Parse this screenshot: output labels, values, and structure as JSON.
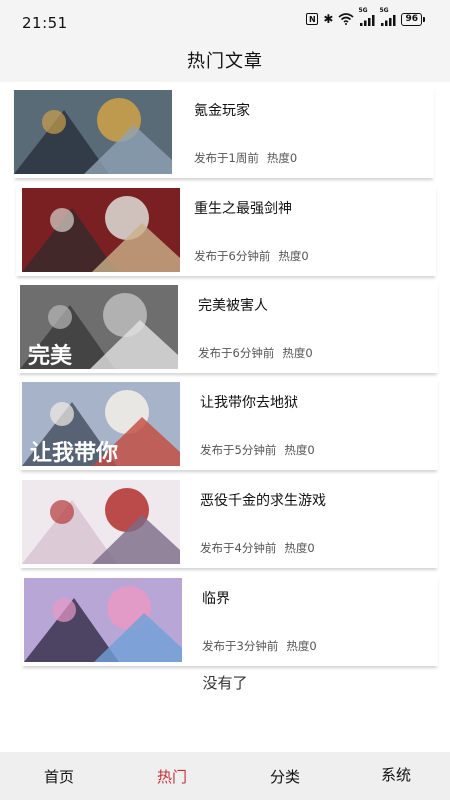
{
  "status_bar": {
    "time": "21:51",
    "icons": [
      "nfc-icon",
      "bluetooth-icon",
      "wifi-icon",
      "signal-5g-icon",
      "signal-5g-icon",
      "battery-icon"
    ],
    "signal_label": "5G",
    "battery": "96"
  },
  "header": {
    "title": "热门文章"
  },
  "articles": [
    {
      "title": "氪金玩家",
      "published": "发布于1周前",
      "heat": "热度0",
      "thumb_colors": [
        "#5a6b78",
        "#c9a04a",
        "#2b3440",
        "#8fa2b4"
      ]
    },
    {
      "title": "重生之最强剑神",
      "published": "发布于6分钟前",
      "heat": "热度0",
      "thumb_colors": [
        "#7a1f22",
        "#d8d3cc",
        "#3a2a2c",
        "#c9b089"
      ]
    },
    {
      "title": "完美被害人",
      "published": "发布于6分钟前",
      "heat": "热度0",
      "thumb_colors": [
        "#6e6e6e",
        "#b8b8b8",
        "#3d3d3d",
        "#e2e2e2"
      ],
      "thumb_text": "完美"
    },
    {
      "title": "让我带你去地狱",
      "published": "发布于5分钟前",
      "heat": "热度0",
      "thumb_colors": [
        "#a7b3c8",
        "#f1ece6",
        "#4a5366",
        "#c44a3d"
      ],
      "thumb_text": "让我带你"
    },
    {
      "title": "恶役千金的求生游戏",
      "published": "发布于4分钟前",
      "heat": "热度0",
      "thumb_colors": [
        "#efe8ec",
        "#b53a3a",
        "#d9c4d3",
        "#7a6a86"
      ]
    },
    {
      "title": "临界",
      "published": "发布于3分钟前",
      "heat": "热度0",
      "thumb_colors": [
        "#b7a6d6",
        "#e59ac4",
        "#3b3350",
        "#6fa1d8"
      ]
    }
  ],
  "end_text": "没有了",
  "nav": {
    "items": [
      {
        "label": "首页"
      },
      {
        "label": "热门"
      },
      {
        "label": "分类"
      },
      {
        "label": "系统"
      }
    ],
    "active_index": 1,
    "active_color": "#c8313a"
  }
}
